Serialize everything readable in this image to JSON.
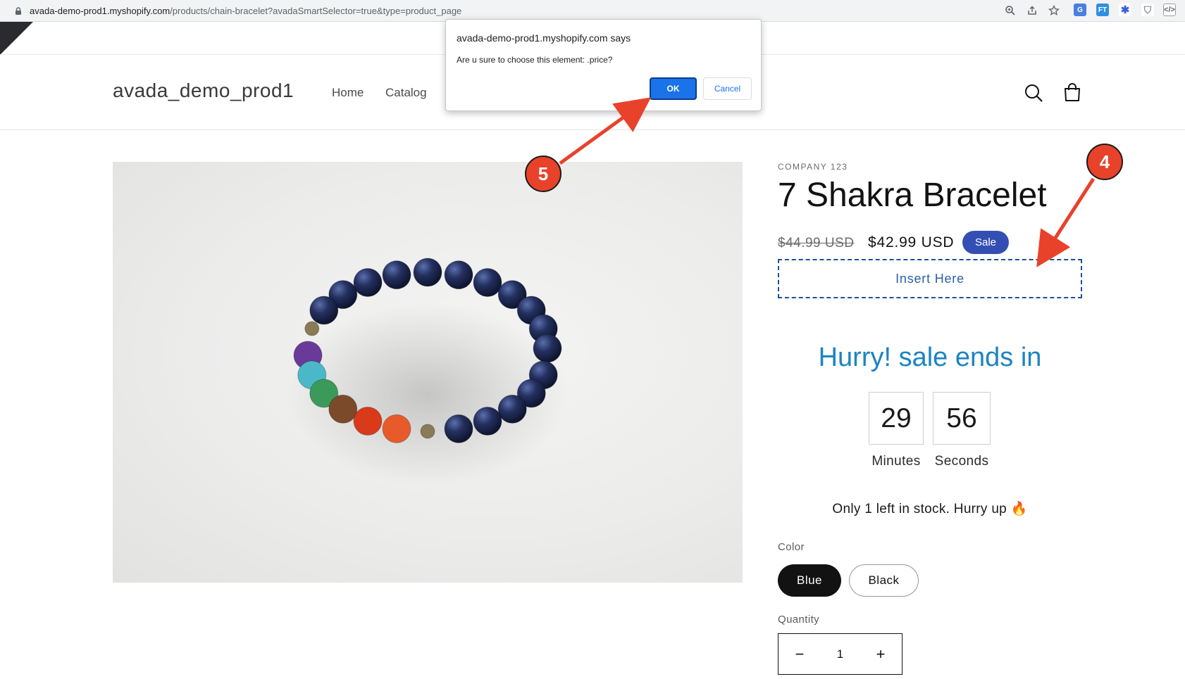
{
  "browser": {
    "url_host": "avada-demo-prod1.myshopify.com",
    "url_path": "/products/chain-bracelet?avadaSmartSelector=true&type=product_page"
  },
  "shop": {
    "logo": "avada_demo_prod1",
    "nav": [
      {
        "label": "Home"
      },
      {
        "label": "Catalog"
      }
    ]
  },
  "product": {
    "vendor": "COMPANY 123",
    "title": "7 Shakra Bracelet",
    "compare_price": "$44.99 USD",
    "price": "$42.99 USD",
    "sale_badge": "Sale",
    "insert_placeholder": "Insert Here"
  },
  "countdown": {
    "heading": "Hurry! sale ends in",
    "minutes": "29",
    "seconds": "56",
    "minutes_label": "Minutes",
    "seconds_label": "Seconds"
  },
  "stock": {
    "text": "Only 1 left in stock. Hurry up 🔥"
  },
  "options": {
    "color_label": "Color",
    "colors": [
      {
        "label": "Blue",
        "selected": true
      },
      {
        "label": "Black",
        "selected": false
      }
    ],
    "quantity_label": "Quantity",
    "quantity_value": "1",
    "minus": "−",
    "plus": "+"
  },
  "dialog": {
    "title": "avada-demo-prod1.myshopify.com says",
    "message": "Are u sure to choose this element: .price?",
    "ok_label": "OK",
    "cancel_label": "Cancel"
  },
  "annotations": {
    "step_a": "5",
    "step_b": "4",
    "color": "#e8422a"
  },
  "colors": {
    "accent_blue": "#334fb4",
    "countdown_blue": "#1b84c3",
    "dialog_ok": "#1a73e8"
  }
}
